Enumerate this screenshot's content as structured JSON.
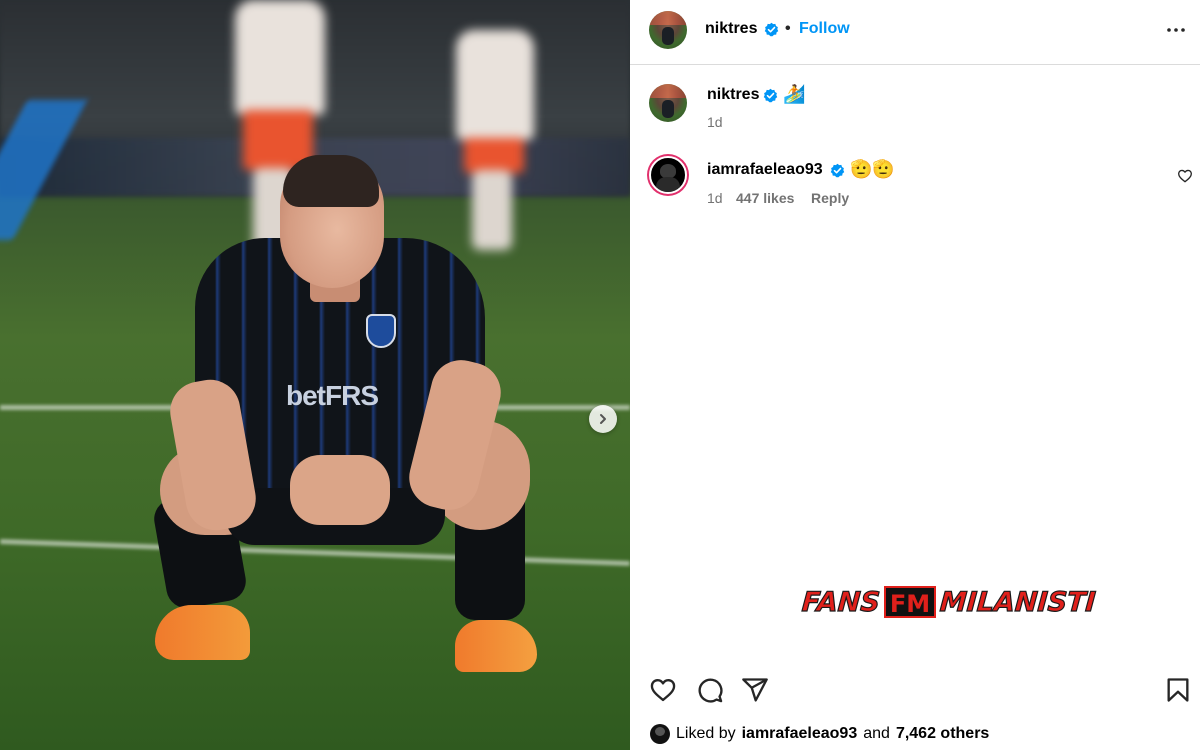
{
  "post": {
    "author": "niktres",
    "follow_label": "Follow",
    "separator": "•"
  },
  "caption": {
    "username": "niktres",
    "emoji": "🏄",
    "time": "1d"
  },
  "comments": [
    {
      "username": "iamrafaeleao93",
      "emoji": "🫡🫡",
      "time": "1d",
      "likes": "447 likes",
      "reply_label": "Reply"
    }
  ],
  "photo": {
    "jersey_text": "betFRS"
  },
  "watermark": {
    "left": "FANS",
    "box": "FM",
    "right": "MILANISTI"
  },
  "likes": {
    "prefix": "Liked by",
    "user": "iamrafaeleao93",
    "middle": "and",
    "others": "7,462 others"
  },
  "icons": {
    "more": "more-horizontal-icon",
    "verified": "verified-badge-icon",
    "like": "heart-icon",
    "comment": "comment-icon",
    "share": "send-icon",
    "save": "bookmark-icon",
    "next": "chevron-right-icon"
  },
  "colors": {
    "link_blue": "#0095f6",
    "verified_blue": "#0095f6",
    "muted_text": "#737373",
    "watermark_red": "#e0201b"
  }
}
